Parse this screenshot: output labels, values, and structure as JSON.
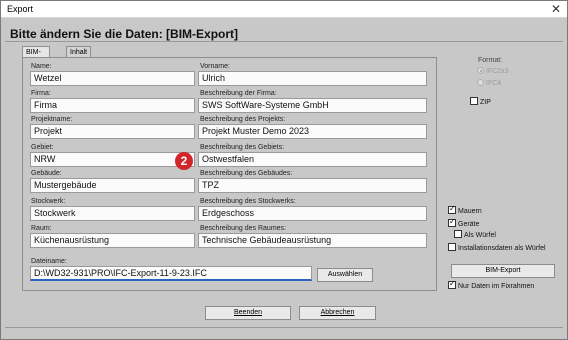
{
  "window": {
    "title": "Export",
    "close_glyph": "✕"
  },
  "heading": "Bitte ändern Sie die Daten:  [BIM-Export]",
  "tabs": [
    {
      "label": "BIM-Export",
      "active": true
    },
    {
      "label": "Inhalt",
      "active": false
    }
  ],
  "fields": {
    "name": {
      "label": "Name:",
      "value": "Wetzel"
    },
    "vorname": {
      "label": "Vorname:",
      "value": "Ulrich"
    },
    "firma": {
      "label": "Firma:",
      "value": "Firma"
    },
    "firma_desc": {
      "label": "Beschreibung der Firma:",
      "value": "SWS SoftWare-Systeme GmbH"
    },
    "projekt": {
      "label": "Projektname:",
      "value": "Projekt"
    },
    "projekt_desc": {
      "label": "Beschreibung des Projekts:",
      "value": "Projekt Muster Demo 2023"
    },
    "gebiet": {
      "label": "Gebiet:",
      "value": "NRW"
    },
    "gebiet_desc": {
      "label": "Beschreibung des Gebiets:",
      "value": "Ostwestfalen"
    },
    "gebaeude": {
      "label": "Gebäude:",
      "value": "Mustergebäude"
    },
    "gebaeude_desc": {
      "label": "Beschreibung des Gebäudes:",
      "value": "TPZ"
    },
    "stockwerk": {
      "label": "Stockwerk:",
      "value": "Stockwerk"
    },
    "stockwerk_desc": {
      "label": "Beschreibung des Stockwerks:",
      "value": "Erdgeschoss"
    },
    "raum": {
      "label": "Raum:",
      "value": "Küchenausrüstung"
    },
    "raum_desc": {
      "label": "Beschreibung des Raumes:",
      "value": "Technische Gebäudeausrüstung"
    },
    "dateiname": {
      "label": "Dateiname:",
      "value": "D:\\WD32-931\\PRO\\IFC-Export-11-9-23.IFC"
    }
  },
  "badge": "2",
  "buttons": {
    "auswaehlen": "Auswählen",
    "bim_export": "BIM-Export",
    "beenden": "Beenden",
    "abbrechen": "Abbrechen"
  },
  "format": {
    "label": "Format:",
    "options": [
      {
        "label": "IFC2x3",
        "selected": true,
        "enabled": false
      },
      {
        "label": "IFC4",
        "selected": false,
        "enabled": false
      }
    ]
  },
  "checkboxes": {
    "zip": {
      "label": "ZIP",
      "checked": false
    },
    "mauern": {
      "label": "Mauern",
      "checked": true
    },
    "geraete": {
      "label": "Geräte",
      "checked": true
    },
    "als_wuerfel": {
      "label": "Als Würfel",
      "checked": false
    },
    "installationsdaten": {
      "label": "Installationsdaten als Würfel",
      "checked": false
    },
    "nur_daten": {
      "label": "Nur Daten im Fixrahmen",
      "checked": true
    }
  },
  "colors": {
    "accent": "#2b63c2",
    "badge": "#d0262a",
    "window_bg": "#c8c8c8"
  }
}
